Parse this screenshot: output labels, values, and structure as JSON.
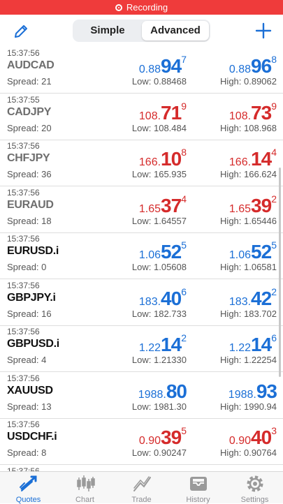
{
  "status_bar": {
    "recording_label": "Recording"
  },
  "header": {
    "segment_simple": "Simple",
    "segment_advanced": "Advanced",
    "active_segment": "Advanced"
  },
  "partial_time": "15:37:56",
  "quotes": [
    {
      "time": "15:37:56",
      "symbol": "AUDCAD",
      "spread": "Spread: 21",
      "symbol_color": "grey",
      "bid": {
        "a": "0.88",
        "b": "94",
        "c": "7",
        "color": "blue"
      },
      "ask": {
        "a": "0.88",
        "b": "96",
        "c": "8",
        "color": "blue"
      },
      "low": "Low: 0.88468",
      "high": "High: 0.89062"
    },
    {
      "time": "15:37:55",
      "symbol": "CADJPY",
      "spread": "Spread: 20",
      "symbol_color": "grey",
      "bid": {
        "a": "108.",
        "b": "71",
        "c": "9",
        "color": "red"
      },
      "ask": {
        "a": "108.",
        "b": "73",
        "c": "9",
        "color": "red"
      },
      "low": "Low: 108.484",
      "high": "High: 108.968"
    },
    {
      "time": "15:37:56",
      "symbol": "CHFJPY",
      "spread": "Spread: 36",
      "symbol_color": "grey",
      "bid": {
        "a": "166.",
        "b": "10",
        "c": "8",
        "color": "red"
      },
      "ask": {
        "a": "166.",
        "b": "14",
        "c": "4",
        "color": "red"
      },
      "low": "Low: 165.935",
      "high": "High: 166.624"
    },
    {
      "time": "15:37:56",
      "symbol": "EURAUD",
      "spread": "Spread: 18",
      "symbol_color": "grey",
      "bid": {
        "a": "1.65",
        "b": "37",
        "c": "4",
        "color": "red"
      },
      "ask": {
        "a": "1.65",
        "b": "39",
        "c": "2",
        "color": "red"
      },
      "low": "Low: 1.64557",
      "high": "High: 1.65446"
    },
    {
      "time": "15:37:56",
      "symbol": "EURUSD.i",
      "spread": "Spread: 0",
      "symbol_color": "black",
      "bid": {
        "a": "1.06",
        "b": "52",
        "c": "5",
        "color": "blue"
      },
      "ask": {
        "a": "1.06",
        "b": "52",
        "c": "5",
        "color": "blue"
      },
      "low": "Low: 1.05608",
      "high": "High: 1.06581"
    },
    {
      "time": "15:37:56",
      "symbol": "GBPJPY.i",
      "spread": "Spread: 16",
      "symbol_color": "black",
      "bid": {
        "a": "183.",
        "b": "40",
        "c": "6",
        "color": "blue"
      },
      "ask": {
        "a": "183.",
        "b": "42",
        "c": "2",
        "color": "blue"
      },
      "low": "Low: 182.733",
      "high": "High: 183.702"
    },
    {
      "time": "15:37:56",
      "symbol": "GBPUSD.i",
      "spread": "Spread: 4",
      "symbol_color": "black",
      "bid": {
        "a": "1.22",
        "b": "14",
        "c": "2",
        "color": "blue"
      },
      "ask": {
        "a": "1.22",
        "b": "14",
        "c": "6",
        "color": "blue"
      },
      "low": "Low: 1.21330",
      "high": "High: 1.22254"
    },
    {
      "time": "15:37:56",
      "symbol": "XAUUSD",
      "spread": "Spread: 13",
      "symbol_color": "black",
      "bid": {
        "a": "1988.",
        "b": "80",
        "c": "",
        "color": "blue"
      },
      "ask": {
        "a": "1988.",
        "b": "93",
        "c": "",
        "color": "blue"
      },
      "low": "Low: 1981.30",
      "high": "High: 1990.94"
    },
    {
      "time": "15:37:56",
      "symbol": "USDCHF.i",
      "spread": "Spread: 8",
      "symbol_color": "black",
      "bid": {
        "a": "0.90",
        "b": "39",
        "c": "5",
        "color": "red"
      },
      "ask": {
        "a": "0.90",
        "b": "40",
        "c": "3",
        "color": "red"
      },
      "low": "Low: 0.90247",
      "high": "High: 0.90764"
    }
  ],
  "tabs": [
    {
      "label": "Quotes",
      "icon": "quotes-icon",
      "active": true
    },
    {
      "label": "Chart",
      "icon": "chart-icon",
      "active": false
    },
    {
      "label": "Trade",
      "icon": "trade-icon",
      "active": false
    },
    {
      "label": "History",
      "icon": "history-icon",
      "active": false
    },
    {
      "label": "Settings",
      "icon": "settings-icon",
      "active": false
    }
  ],
  "colors": {
    "accent": "#1b6fd6",
    "down": "#d52b2b",
    "recording": "#ef3b3b"
  }
}
